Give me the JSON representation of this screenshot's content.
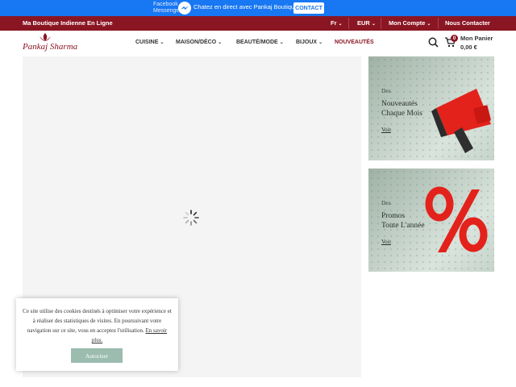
{
  "messenger": {
    "brand_line1": "Facebook",
    "brand_line2": "Messenger",
    "chat_text": "Chatez en direct avec Pankaj Boutique",
    "contact_label": "CONTACT",
    "icon": "messenger-icon"
  },
  "topbar": {
    "tagline": "Ma Boutique Indienne En Ligne",
    "language": "Fr",
    "currency": "EUR",
    "account": "Mon Compte",
    "contact": "Nous Contacter",
    "color": "#8b1623"
  },
  "header": {
    "logo_text": "Pankaj Sharma",
    "nav": [
      {
        "label": "CUISINE"
      },
      {
        "label": "MAISON/DÉCO"
      },
      {
        "label": "BEAUTÉ/MODE"
      },
      {
        "label": "BIJOUX"
      },
      {
        "label": "NOUVEAUTÉS"
      }
    ],
    "cart_count": "0",
    "cart_label": "Mon Panier",
    "cart_total": "0,00 €"
  },
  "banners": [
    {
      "kicker": "Des",
      "title_line1": "Nouveautés",
      "title_line2": "Chaque Mois",
      "link": "Voir",
      "icon": "megaphone-icon"
    },
    {
      "kicker": "Des",
      "title_line1": "Promos",
      "title_line2": "Toute L'année",
      "link": "Voir",
      "icon": "percent-icon"
    }
  ],
  "cookie": {
    "text": "Ce site utilise des cookies destinés à optimiser votre expérience et à réaliser des statistiques de visites. En poursuivant votre navigation sur ce site, vous en acceptez l'utilisation.",
    "link": "En savoir plus.",
    "button": "Autoriser"
  }
}
